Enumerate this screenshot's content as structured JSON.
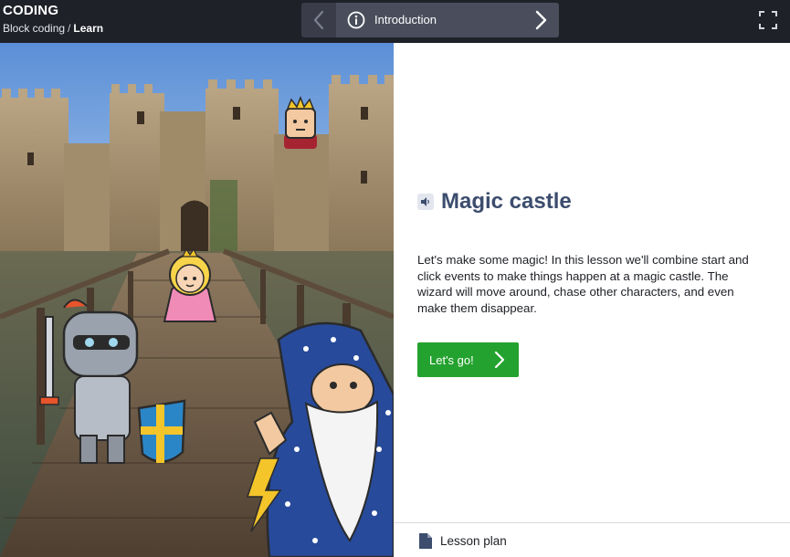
{
  "header": {
    "brand": "CODING",
    "breadcrumb": {
      "parent": "Block coding",
      "separator": "/",
      "current": "Learn"
    },
    "nav": {
      "title": "Introduction",
      "prev_icon": "chevron-left-icon",
      "next_icon": "chevron-right-icon",
      "info_icon": "info-icon"
    },
    "fullscreen_icon": "fullscreen-icon"
  },
  "lesson": {
    "title": "Magic castle",
    "description": "Let's make some magic! In this lesson we'll combine start and click events to make things happen at a magic castle. The wizard will move around, chase other characters, and even make them disappear.",
    "cta_label": "Let's go!",
    "audio_icon": "speaker-icon"
  },
  "footer": {
    "lesson_plan_label": "Lesson plan",
    "icon": "document-icon"
  },
  "colors": {
    "topbar": "#1f2129",
    "nav": "#3a3d49",
    "title": "#3c4d6e",
    "cta": "#24a22f"
  },
  "scene": {
    "characters": [
      "knight",
      "princess",
      "king",
      "wizard"
    ],
    "setting": "castle"
  }
}
